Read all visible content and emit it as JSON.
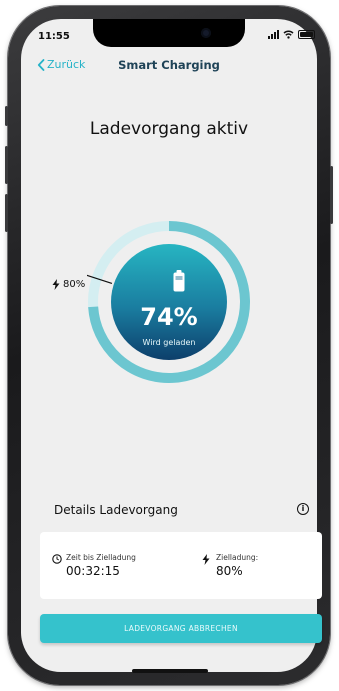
{
  "status_bar": {
    "time": "11:55"
  },
  "nav": {
    "back_label": "Zurück",
    "title": "Smart Charging"
  },
  "headline": "Ladevorgang aktiv",
  "gauge": {
    "target_label": "80%",
    "percent_text": "74%",
    "state_label": "Wird geladen",
    "charge_fraction": 0.74,
    "target_fraction": 0.8
  },
  "details": {
    "title": "Details Ladevorgang",
    "time_label": "Zeit bis Zielladung",
    "time_value": "00:32:15",
    "target_label": "Zielladung:",
    "target_value": "80%"
  },
  "actions": {
    "cancel_label": "LADEVORGANG ABBRECHEN"
  },
  "colors": {
    "accent": "#26b3c8",
    "button": "#35c2cc",
    "gauge_top": "#27b5c2",
    "gauge_bottom": "#0d3f6b",
    "ring": "#6cc6d0"
  },
  "icons": [
    "chevron-left-icon",
    "signal-icon",
    "wifi-icon",
    "battery-icon",
    "bolt-icon",
    "clock-icon",
    "info-icon"
  ]
}
